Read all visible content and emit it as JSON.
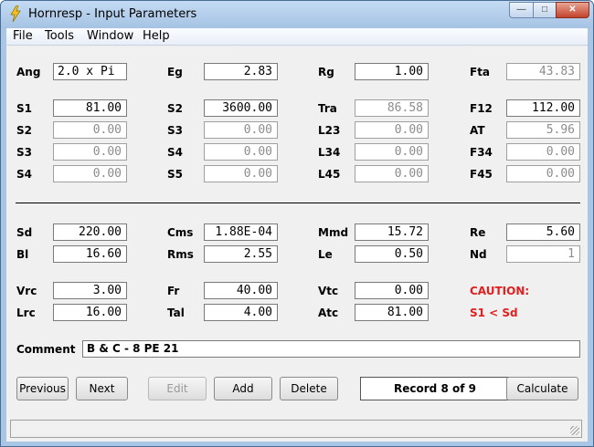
{
  "window": {
    "title": "Hornresp - Input Parameters"
  },
  "menu": [
    "File",
    "Tools",
    "Window",
    "Help"
  ],
  "labels": {
    "ang": "Ang",
    "eg": "Eg",
    "rg": "Rg",
    "fta": "Fta",
    "s1": "S1",
    "s2": "S2",
    "tra": "Tra",
    "f12": "F12",
    "s2b": "S2",
    "s3": "S3",
    "l23": "L23",
    "at": "AT",
    "s3b": "S3",
    "s4": "S4",
    "l34": "L34",
    "f34": "F34",
    "s4b": "S4",
    "s5": "S5",
    "l45": "L45",
    "f45": "F45",
    "sd": "Sd",
    "cms": "Cms",
    "mmd": "Mmd",
    "re": "Re",
    "bl": "Bl",
    "rms": "Rms",
    "le": "Le",
    "nd": "Nd",
    "vrc": "Vrc",
    "fr": "Fr",
    "vtc": "Vtc",
    "lrc": "Lrc",
    "tal": "Tal",
    "atc": "Atc",
    "comment": "Comment"
  },
  "values": {
    "ang": "2.0 x Pi",
    "eg": "2.83",
    "rg": "1.00",
    "fta": "43.83",
    "s1": "81.00",
    "s2": "3600.00",
    "tra": "86.58",
    "f12": "112.00",
    "s2b": "0.00",
    "s3": "0.00",
    "l23": "0.00",
    "at": "5.96",
    "s3b": "0.00",
    "s4": "0.00",
    "l34": "0.00",
    "f34": "0.00",
    "s4b": "0.00",
    "s5": "0.00",
    "l45": "0.00",
    "f45": "0.00",
    "sd": "220.00",
    "cms": "1.88E-04",
    "mmd": "15.72",
    "re": "5.60",
    "bl": "16.60",
    "rms": "2.55",
    "le": "0.50",
    "nd": "1",
    "vrc": "3.00",
    "fr": "40.00",
    "vtc": "0.00",
    "lrc": "16.00",
    "tal": "4.00",
    "atc": "81.00",
    "comment": "B & C - 8 PE 21"
  },
  "caution": {
    "title": "CAUTION:",
    "message": "S1 < Sd",
    "color": "#e21e1e"
  },
  "buttons": {
    "previous": "Previous",
    "next": "Next",
    "edit": "Edit",
    "add": "Add",
    "delete": "Delete",
    "calculate": "Calculate"
  },
  "record": "Record 8 of 9",
  "status": ""
}
